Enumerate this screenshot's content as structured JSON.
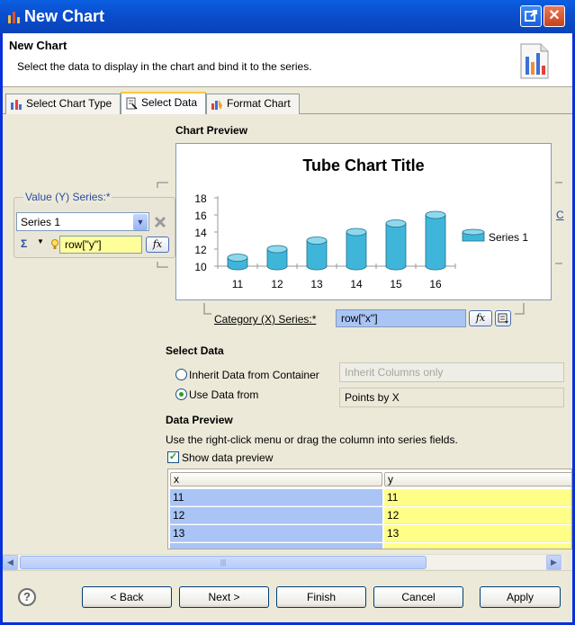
{
  "window": {
    "title": "New Chart",
    "close_label": "✕"
  },
  "header": {
    "title": "New Chart",
    "description": "Select the data to display in the chart and bind it to the series."
  },
  "tabs": [
    {
      "label": "Select Chart Type"
    },
    {
      "label": "Select Data"
    },
    {
      "label": "Format Chart"
    }
  ],
  "preview": {
    "heading": "Chart Preview",
    "category_label": "Category (X) Series:*",
    "category_value": "row[\"x\"]",
    "right_edge_letter": "C"
  },
  "value_series": {
    "title": "Value (Y) Series:*",
    "series_selected": "Series 1",
    "expression": "row[\"y\"]",
    "sigma": "Σ"
  },
  "fx_label": "fx",
  "chart_data": {
    "type": "bar",
    "title": "Tube Chart Title",
    "categories": [
      "11",
      "12",
      "13",
      "14",
      "15",
      "16"
    ],
    "series": [
      {
        "name": "Series 1",
        "values": [
          11,
          12,
          13,
          14,
          15,
          16
        ]
      }
    ],
    "ylim": [
      10,
      18
    ],
    "yticks": [
      "10",
      "12",
      "14",
      "16",
      "18"
    ],
    "legend_position": "right",
    "bar_color": "#3FB6D9"
  },
  "select_data": {
    "heading": "Select Data",
    "option_inherit": "Inherit Data from Container",
    "option_inherit_value": "Inherit Columns only",
    "option_use": "Use Data from",
    "option_use_value": "Points by X"
  },
  "data_preview": {
    "heading": "Data Preview",
    "instructions": "Use the right-click menu or drag the column into series fields.",
    "show_label": "Show data preview",
    "columns": [
      "x",
      "y"
    ],
    "rows": [
      [
        "11",
        "11"
      ],
      [
        "12",
        "12"
      ],
      [
        "13",
        "13"
      ]
    ]
  },
  "scroll_grip": "|||",
  "buttons": {
    "help": "?",
    "back": "< Back",
    "next": "Next >",
    "finish": "Finish",
    "cancel": "Cancel",
    "apply": "Apply"
  }
}
